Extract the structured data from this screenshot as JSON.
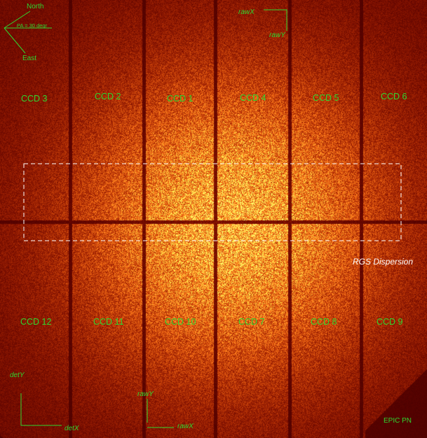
{
  "instrument": "EPIC PN",
  "ccd_top": [
    "CCD 3",
    "CCD 2",
    "CCD 1",
    "CCD 4",
    "CCD 5",
    "CCD 6"
  ],
  "ccd_bottom": [
    "CCD 12",
    "CCD 11",
    "CCD 10",
    "CCD 7",
    "CCD 8",
    "CCD 9"
  ],
  "compass": {
    "north": "North",
    "east": "East",
    "pa": "PA = 30 degr"
  },
  "raw_axes_top": {
    "x": "rawX",
    "y": "rawY"
  },
  "raw_axes_bottom": {
    "x": "rawX",
    "y": "rawY"
  },
  "det_axes": {
    "x": "detX",
    "y": "detY"
  },
  "rgs_label": "RGS Dispersion",
  "colors": {
    "labels": "#2fd62f",
    "rgs_box": "#ffffff",
    "background": "#3a0600"
  }
}
